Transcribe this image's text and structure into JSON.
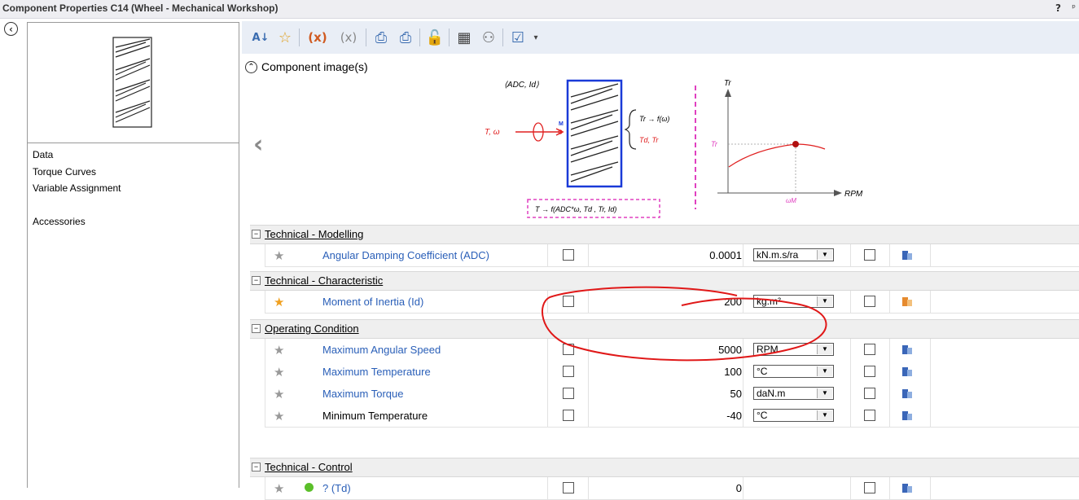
{
  "window": {
    "title": "Component Properties C14 (Wheel - Mechanical Workshop)",
    "help": "?",
    "pin": "ᵖ"
  },
  "left": {
    "items": [
      {
        "label": "Data"
      },
      {
        "label": "Torque Curves"
      },
      {
        "label": "Variable Assignment"
      },
      {
        "label": "Accessories"
      }
    ]
  },
  "image_section": {
    "label": "Component image(s)"
  },
  "diagram": {
    "params": "⟨ADC, Id⟩",
    "input": "T, ω",
    "node": "M",
    "out1": "Tr → f(ω)",
    "out2": "Td, Tr",
    "formula": "T → f(ADC*ω, Td , Tr, Id)",
    "y_axis": "Tr",
    "y_tick": "Tr",
    "x_axis": "RPM",
    "x_tick": "ωM"
  },
  "groups": [
    {
      "label": "Technical - Modelling",
      "rows": [
        {
          "name": "Angular Damping Coefficient (ADC)",
          "value": "0.0001",
          "unit": "kN.m.s/ra",
          "fav": false,
          "link": true,
          "dot": false,
          "lib": "blue"
        }
      ]
    },
    {
      "label": "Technical - Characteristic",
      "rows": [
        {
          "name": "Moment of Inertia (Id)",
          "value": "200",
          "unit": "kg.m²",
          "fav": true,
          "link": true,
          "dot": false,
          "lib": "orange"
        }
      ]
    },
    {
      "label": "Operating Condition",
      "rows": [
        {
          "name": "Maximum Angular Speed",
          "value": "5000",
          "unit": "RPM",
          "fav": false,
          "link": true,
          "dot": false,
          "lib": "blue"
        },
        {
          "name": "Maximum Temperature",
          "value": "100",
          "unit": "°C",
          "fav": false,
          "link": true,
          "dot": false,
          "lib": "blue"
        },
        {
          "name": "Maximum Torque",
          "value": "50",
          "unit": "daN.m",
          "fav": false,
          "link": true,
          "dot": false,
          "lib": "blue"
        },
        {
          "name": "Minimum Temperature",
          "value": "-40",
          "unit": "°C",
          "fav": false,
          "link": false,
          "dot": false,
          "lib": "blue"
        }
      ]
    },
    {
      "label": "Technical - Control",
      "rows": [
        {
          "name": "? (Td)",
          "value": "0",
          "unit": "",
          "fav": false,
          "link": true,
          "dot": true,
          "lib": "blue"
        }
      ]
    }
  ]
}
